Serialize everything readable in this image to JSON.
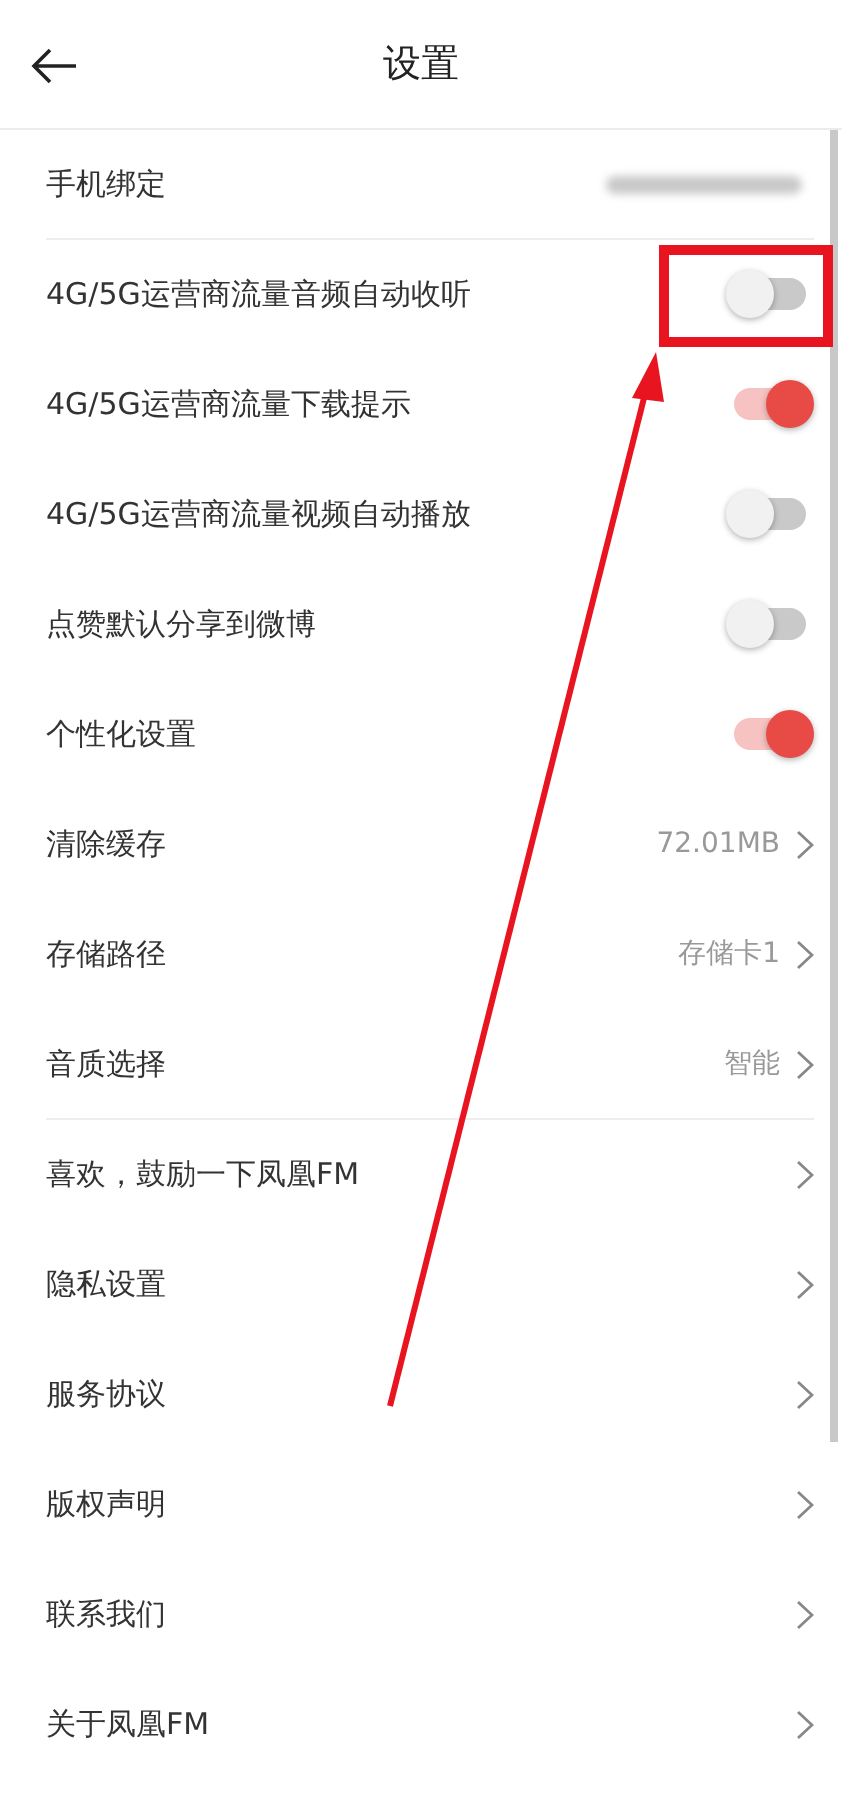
{
  "header": {
    "title": "设置"
  },
  "rows": [
    {
      "kind": "blurred",
      "label": "手机绑定",
      "divider": true
    },
    {
      "kind": "toggle",
      "label": "4G/5G运营商流量音频自动收听",
      "on": false
    },
    {
      "kind": "toggle",
      "label": "4G/5G运营商流量下载提示",
      "on": true
    },
    {
      "kind": "toggle",
      "label": "4G/5G运营商流量视频自动播放",
      "on": false
    },
    {
      "kind": "toggle",
      "label": "点赞默认分享到微博",
      "on": false
    },
    {
      "kind": "toggle",
      "label": "个性化设置",
      "on": true
    },
    {
      "kind": "link",
      "label": "清除缓存",
      "value": "72.01MB"
    },
    {
      "kind": "link",
      "label": "存储路径",
      "value": "存储卡1"
    },
    {
      "kind": "link",
      "label": "音质选择",
      "value": "智能",
      "divider": true
    },
    {
      "kind": "link",
      "label": "喜欢，鼓励一下凤凰FM"
    },
    {
      "kind": "link",
      "label": "隐私设置"
    },
    {
      "kind": "link",
      "label": "服务协议"
    },
    {
      "kind": "link",
      "label": "版权声明"
    },
    {
      "kind": "link",
      "label": "联系我们"
    },
    {
      "kind": "link",
      "label": "关于凤凰FM"
    }
  ]
}
